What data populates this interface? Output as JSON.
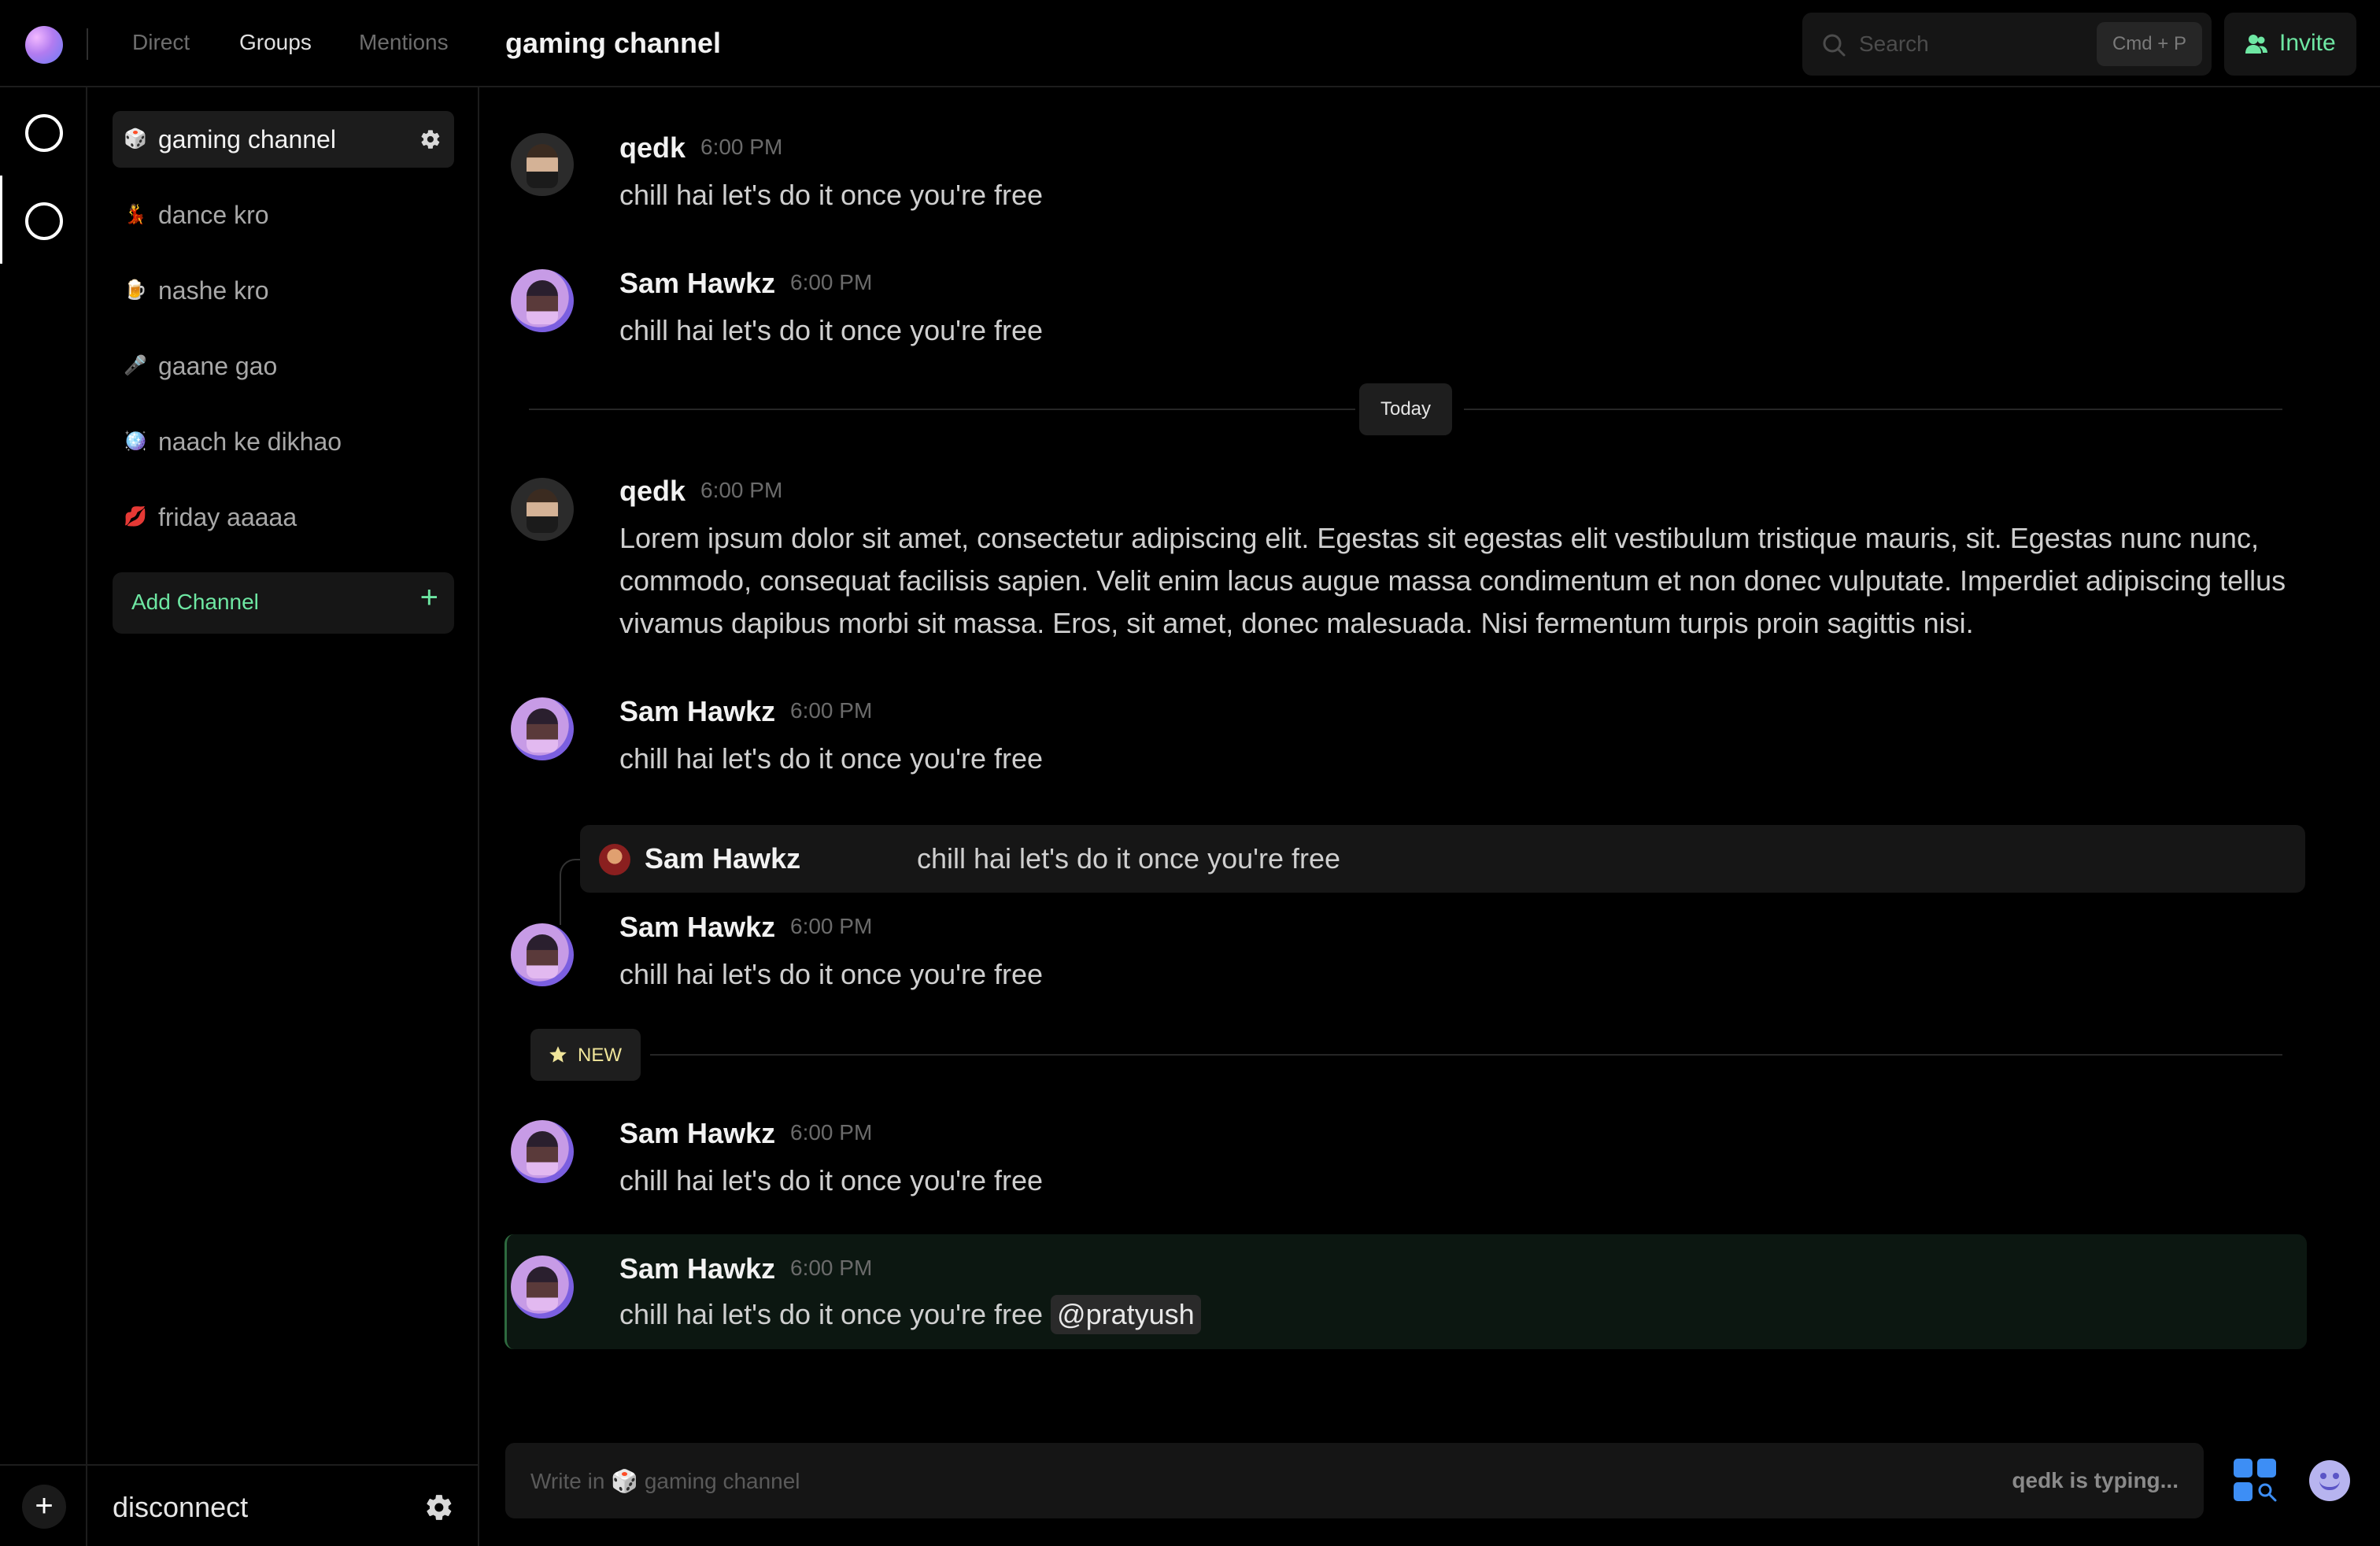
{
  "header": {
    "tabs": [
      {
        "label": "Direct",
        "active": false
      },
      {
        "label": "Groups",
        "active": true
      },
      {
        "label": "Mentions",
        "active": false
      }
    ],
    "channel_title": "gaming channel",
    "search": {
      "placeholder": "Search",
      "shortcut": "Cmd + P",
      "icon": "search-icon"
    },
    "invite": {
      "label": "Invite",
      "icon": "users-icon"
    }
  },
  "sidebar": {
    "channels": [
      {
        "emoji": "🎲",
        "label": "gaming channel",
        "active": true
      },
      {
        "emoji": "💃",
        "label": "dance kro",
        "active": false
      },
      {
        "emoji": "🍺",
        "label": "nashe kro",
        "active": false
      },
      {
        "emoji": "🎤",
        "label": "gaane gao",
        "active": false
      },
      {
        "emoji": "🪩",
        "label": "naach ke dikhao",
        "active": false
      },
      {
        "emoji": "💋",
        "label": "friday aaaaa",
        "active": false
      }
    ],
    "add_channel": {
      "label": "Add Channel",
      "plus": "+"
    },
    "user": {
      "name": "disconnect"
    }
  },
  "rail": {
    "add": "+"
  },
  "messages": [
    {
      "author": "qedk",
      "time": "6:00 PM",
      "text": "chill hai let's do it once you're free"
    },
    {
      "author": "Sam Hawkz",
      "time": "6:00 PM",
      "text": "chill hai let's do it once you're free"
    },
    {
      "author": "qedk",
      "time": "6:00 PM",
      "text": "Lorem ipsum dolor sit amet, consectetur adipiscing elit. Egestas sit egestas elit vestibulum tristique mauris, sit. Egestas nunc nunc, commodo, consequat facilisis sapien. Velit enim lacus augue massa condimentum et non donec vulputate. Imperdiet adipiscing tellus vivamus dapibus morbi sit massa. Eros, sit amet, donec malesuada. Nisi fermentum turpis proin sagittis nisi."
    },
    {
      "author": "Sam Hawkz",
      "time": "6:00 PM",
      "text": "chill hai let's do it once you're free"
    },
    {
      "author": "Sam Hawkz",
      "time": "6:00 PM",
      "text": "chill hai let's do it once you're free"
    },
    {
      "author": "Sam Hawkz",
      "time": "6:00 PM",
      "text": "chill hai let's do it once you're free"
    },
    {
      "author": "Sam Hawkz",
      "time": "6:00 PM",
      "text": "chill hai let's do it once you're free",
      "mention": "@pratyush"
    }
  ],
  "reply": {
    "author": "Sam Hawkz",
    "text": "chill hai let's do it once you're free"
  },
  "dividers": {
    "today": "Today",
    "new": "NEW"
  },
  "composer": {
    "placeholder_prefix": "Write in",
    "placeholder_emoji": "🎲",
    "placeholder_channel": "gaming channel",
    "typing": "qedk is typing..."
  },
  "colors": {
    "accent_green": "#6ee7a3",
    "highlight_bg": "#0c1711",
    "new_badge": "#f0e59a"
  }
}
